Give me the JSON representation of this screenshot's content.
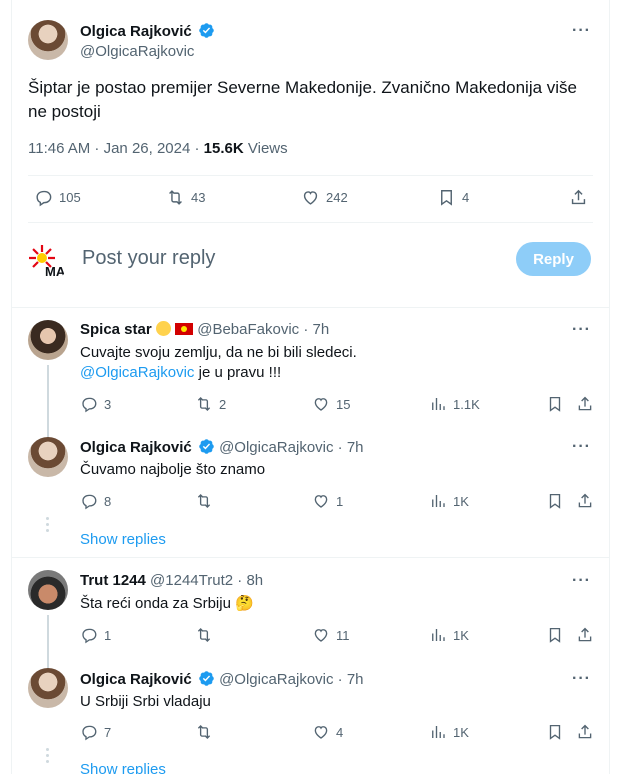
{
  "main_tweet": {
    "author_name": "Olgica Rajković",
    "author_handle": "@OlgicaRajkovic",
    "text": "Šiptar je postao premijer Severne Makedonije. Zvanično Makedonija više ne postoji",
    "time": "11:46 AM · Jan 26, 2024 ·",
    "views_count": "15.6K",
    "views_label": "Views",
    "replies": "105",
    "reposts": "43",
    "likes": "242",
    "bookmarks": "4"
  },
  "composer": {
    "placeholder": "Post your reply",
    "button_label": "Reply"
  },
  "replies": [
    {
      "name": "Spica star",
      "handle": "@BebaFakovic",
      "time": "· 7h",
      "text_line1": "Cuvajte svoju zemlju, da ne bi bili sledeci.",
      "mention": "@OlgicaRajkovic",
      "text_line2_rest": " je u pravu !!!",
      "reply_count": "3",
      "repost_count": "2",
      "like_count": "15",
      "view_count": "1.1K"
    },
    {
      "name": "Olgica Rajković",
      "handle": "@OlgicaRajkovic",
      "time": "· 7h",
      "text": "Čuvamo najbolje što znamo",
      "reply_count": "8",
      "repost_count": "",
      "like_count": "1",
      "view_count": "1K",
      "show_replies": "Show replies"
    },
    {
      "name": "Trut 1244",
      "handle": "@1244Trut2",
      "time": "· 8h",
      "text": "Šta reći onda za Srbiju 🤔",
      "reply_count": "1",
      "repost_count": "",
      "like_count": "11",
      "view_count": "1K"
    },
    {
      "name": "Olgica Rajković",
      "handle": "@OlgicaRajkovic",
      "time": "· 7h",
      "text": "U Srbiji Srbi vladaju",
      "reply_count": "7",
      "repost_count": "",
      "like_count": "4",
      "view_count": "1K",
      "show_replies": "Show replies"
    }
  ],
  "icons": {
    "more": "more-icon",
    "verified": "verified-badge-icon",
    "reply": "reply-icon",
    "repost": "repost-icon",
    "like": "heart-icon",
    "views": "views-icon",
    "bookmark": "bookmark-icon",
    "share": "share-icon"
  },
  "colors": {
    "accent": "#1d9bf0",
    "reply_button": "#8ecdf8",
    "muted": "#536471"
  }
}
